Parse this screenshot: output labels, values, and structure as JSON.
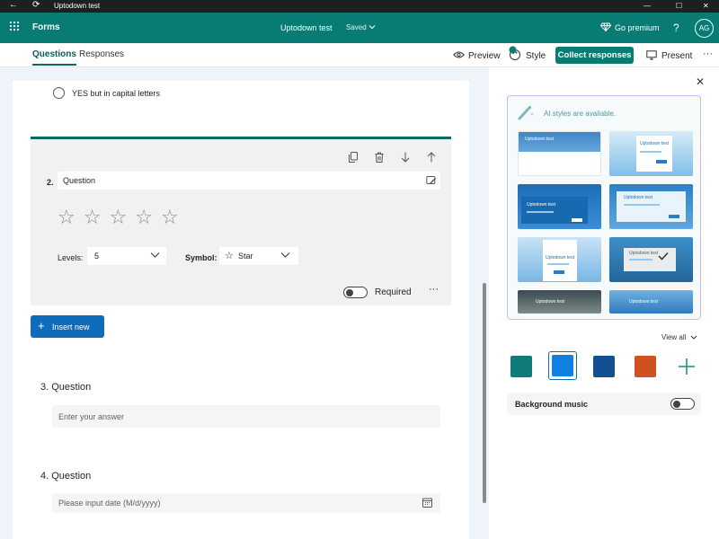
{
  "window": {
    "title": "Uptodown test",
    "minimize_glyph": "—",
    "maximize_glyph": "☐",
    "close_glyph": "✕"
  },
  "appbar": {
    "app_name": "Forms",
    "form_title": "Uptodown test",
    "saved_status": "Saved",
    "go_premium": "Go premium",
    "help": "?",
    "avatar_initials": "AG"
  },
  "tabs": {
    "questions": "Questions",
    "responses": "Responses"
  },
  "toolbar": {
    "preview": "Preview",
    "style": "Style",
    "collect_responses": "Collect responses",
    "present": "Present",
    "more": "···"
  },
  "form": {
    "option_text": "YES but in capital letters",
    "q2": {
      "number": "2.",
      "title": "Question",
      "stars": [
        "☆",
        "☆",
        "☆",
        "☆",
        "☆"
      ],
      "levels_label": "Levels:",
      "levels_value": "5",
      "symbol_label": "Symbol:",
      "symbol_value": "Star",
      "required_label": "Required",
      "more": "···"
    },
    "insert_new": "Insert new",
    "q3": {
      "title": "3. Question",
      "placeholder": "Enter your answer"
    },
    "q4": {
      "title": "4. Question",
      "placeholder": "Please input date (M/d/yyyy)"
    }
  },
  "style_panel": {
    "ai_banner": "AI styles are available.",
    "theme_label": "Uptodown test",
    "view_all": "View all",
    "background_music": "Background music",
    "colors": {
      "teal": "#0f7b7a",
      "blue": "#1180e0",
      "navy": "#114f91",
      "orange": "#d1501f",
      "brand": "#087c73",
      "primary": "#0f6cbd"
    }
  }
}
